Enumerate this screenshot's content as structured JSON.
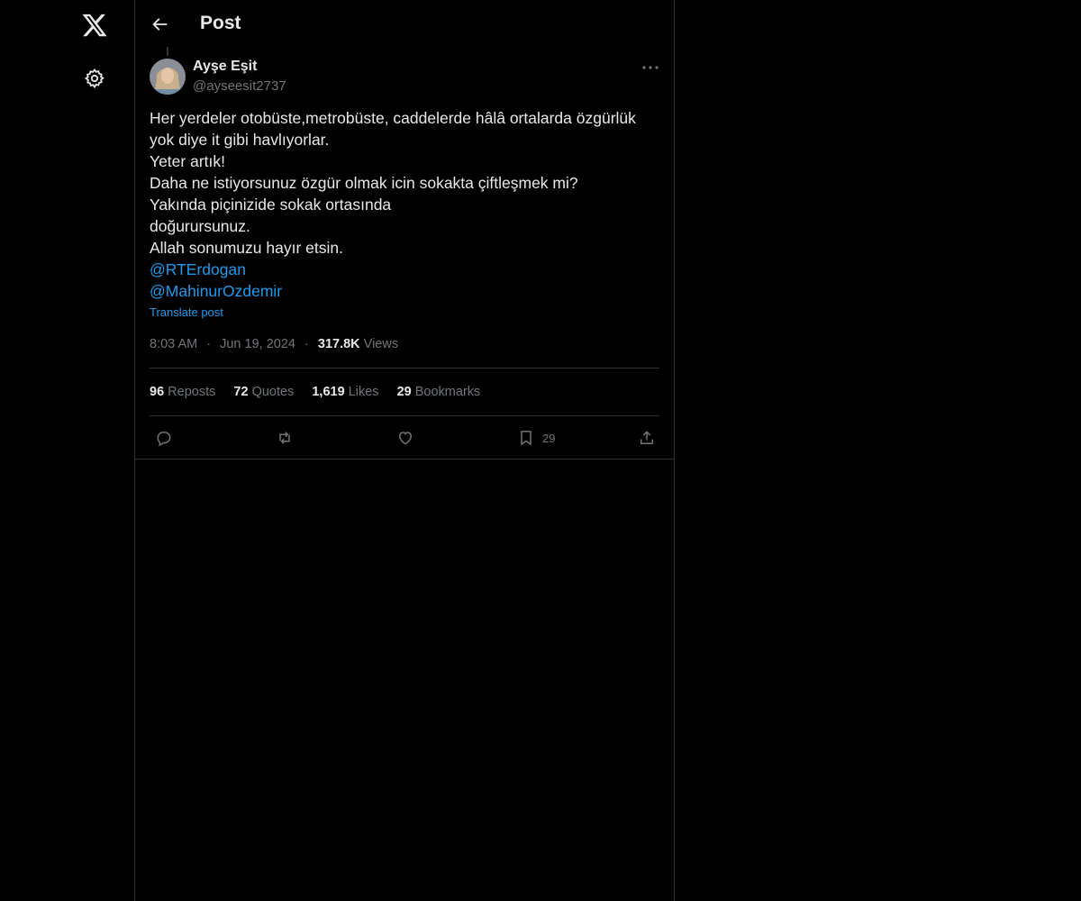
{
  "nav": {
    "logo_icon": "x-logo-icon",
    "settings_icon": "gear-icon"
  },
  "header": {
    "title": "Post",
    "back_icon": "arrow-left-icon"
  },
  "post": {
    "author_name": "Ayşe Eşit",
    "author_handle": "@ayseesit2737",
    "lines": [
      "Her yerdeler otobüste,metrobüste, caddelerde hâlâ ortalarda özgürlük",
      "yok diye it gibi havlıyorlar.",
      "Yeter artık!",
      "Daha ne istiyorsunuz özgür olmak icin sokakta çiftleşmek mi?",
      "Yakında piçinizide sokak ortasında",
      "doğurursunuz.",
      "Allah sonumuzu hayır etsin."
    ],
    "mentions": [
      "@RTErdogan",
      "@MahinurOzdemir"
    ],
    "translate_label": "Translate post",
    "time": "8:03 AM",
    "separator": "·",
    "date": "Jun 19, 2024",
    "views_count": "317.8K",
    "views_label": "Views"
  },
  "stats": {
    "reposts_count": "96",
    "reposts_label": "Reposts",
    "quotes_count": "72",
    "quotes_label": "Quotes",
    "likes_count": "1,619",
    "likes_label": "Likes",
    "bookmarks_count": "29",
    "bookmarks_label": "Bookmarks"
  },
  "actions": {
    "reply_icon": "reply-icon",
    "repost_icon": "repost-icon",
    "like_icon": "heart-icon",
    "bookmark_icon": "bookmark-icon",
    "bookmark_count": "29",
    "share_icon": "share-icon"
  },
  "colors": {
    "background": "#000000",
    "text": "#e7e9ea",
    "muted": "#71767b",
    "link": "#1d9bf0",
    "border": "#2f3336"
  }
}
